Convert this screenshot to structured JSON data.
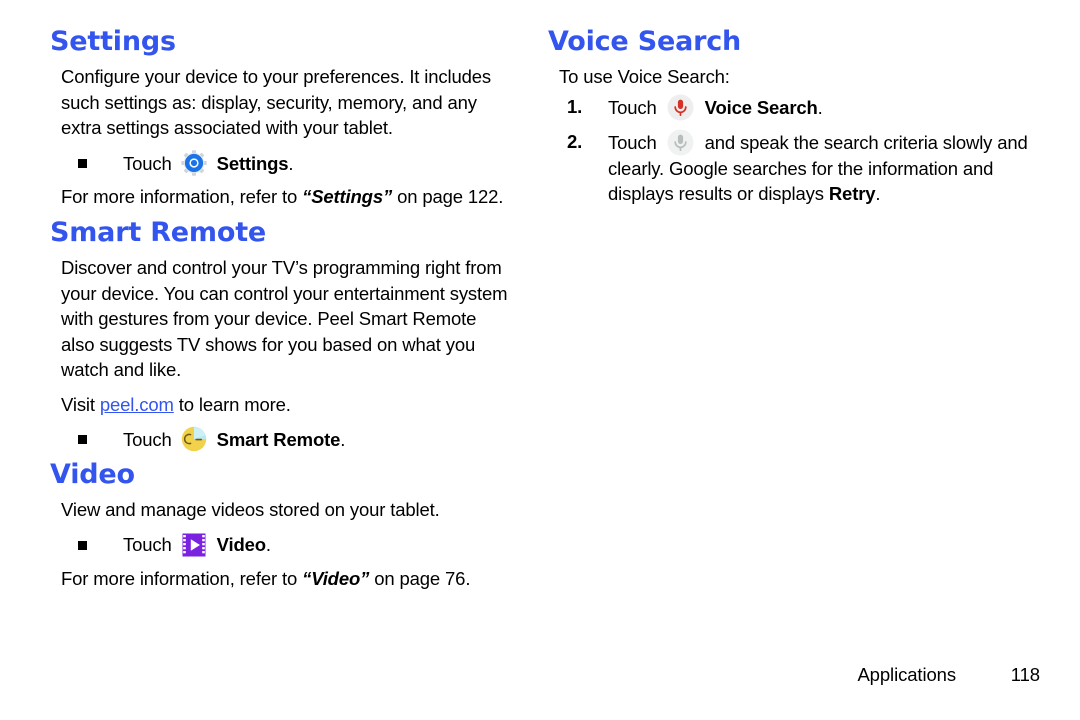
{
  "document": {
    "footer": {
      "chapter": "Applications",
      "page_number": "118"
    },
    "colors": {
      "heading_blue": "#3355ee",
      "link_blue": "#3355ee",
      "body_black": "#000000",
      "settings_icon_blue": "#1a73e8",
      "smart_remote_yellow": "#f2d14b",
      "smart_remote_cyan": "#b9e8f2",
      "video_purple": "#7a22e0",
      "mic_active_red": "#d93025",
      "mic_inactive_gray": "#b8bdbd",
      "mic_circle_bg": "#eeeeee"
    }
  },
  "left_column": {
    "settings": {
      "heading": "Settings",
      "paragraph": "Configure your device to your preferences. It includes such settings as: display, security, memory, and any extra settings associated with your tablet.",
      "bullet": {
        "touch_label": "Touch",
        "icon": "settings-gear-icon",
        "app_name": "Settings",
        "period": "."
      },
      "cross_reference": {
        "lead": "For more information, refer to",
        "title": "“Settings”",
        "tail": "on page 122."
      }
    },
    "smart_remote": {
      "heading": "Smart Remote",
      "paragraph": "Discover and control your TV’s programming right from your device. You can control your entertainment system with gestures from your device. Peel Smart Remote also suggests TV shows for you based on what you watch and like.",
      "visit_line": {
        "lead": "Visit",
        "link_text": "peel.com",
        "tail": "to learn more."
      },
      "bullet": {
        "touch_label": "Touch",
        "icon": "smart-remote-icon",
        "app_name": "Smart Remote",
        "period": "."
      }
    },
    "video": {
      "heading": "Video",
      "paragraph": "View and manage videos stored on your tablet.",
      "bullet": {
        "touch_label": "Touch",
        "icon": "video-icon",
        "app_name": "Video",
        "period": "."
      },
      "cross_reference": {
        "lead": "For more information, refer to",
        "title": "“Video”",
        "tail": "on page 76."
      }
    }
  },
  "right_column": {
    "voice_search": {
      "heading": "Voice Search",
      "intro": "To use Voice Search:",
      "steps": [
        {
          "number": "1.",
          "touch_label": "Touch",
          "icon": "microphone-red-icon",
          "bold_text": "Voice Search",
          "period": "."
        },
        {
          "number": "2.",
          "touch_label": "Touch",
          "icon": "microphone-gray-icon",
          "text_before": "and speak the search criteria slowly and clearly. Google searches for the information and displays results or displays",
          "bold_text": "Retry",
          "period": "."
        }
      ]
    }
  }
}
